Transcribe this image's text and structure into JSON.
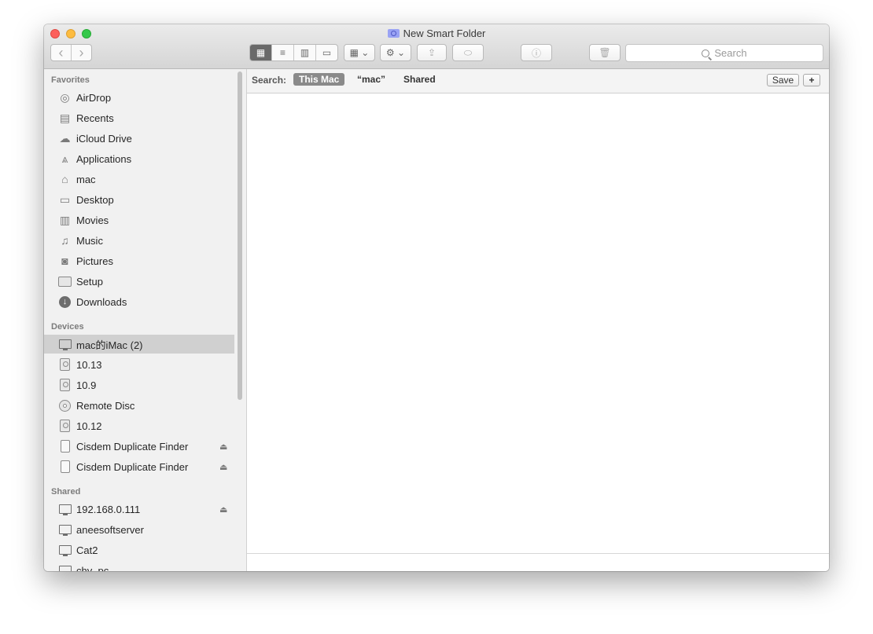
{
  "window": {
    "title": "New Smart Folder"
  },
  "toolbar": {
    "back_icon": "‹",
    "forward_icon": "›",
    "view_icons": [
      "▦",
      "≡",
      "▥",
      "▭"
    ],
    "group_icon": "▦ ⌄",
    "action_icon": "⚙ ⌄",
    "share_icon": "⇪",
    "tag_icon": "⬭",
    "info_icon": "ⓘ",
    "trash_icon": "🗑",
    "search_placeholder": "Search"
  },
  "sidebar": {
    "favorites_title": "Favorites",
    "favorites": [
      {
        "label": "AirDrop",
        "icon": "airdrop-icon"
      },
      {
        "label": "Recents",
        "icon": "recents-icon"
      },
      {
        "label": "iCloud Drive",
        "icon": "cloud-icon"
      },
      {
        "label": "Applications",
        "icon": "applications-icon"
      },
      {
        "label": "mac",
        "icon": "home-icon"
      },
      {
        "label": "Desktop",
        "icon": "desktop-icon"
      },
      {
        "label": "Movies",
        "icon": "film-icon"
      },
      {
        "label": "Music",
        "icon": "music-icon"
      },
      {
        "label": "Pictures",
        "icon": "camera-icon"
      },
      {
        "label": "Setup",
        "icon": "folder-icon"
      },
      {
        "label": "Downloads",
        "icon": "download-icon"
      }
    ],
    "devices_title": "Devices",
    "devices": [
      {
        "label": "mac的iMac (2)",
        "icon": "imac-icon",
        "selected": true
      },
      {
        "label": "10.13",
        "icon": "disk-icon"
      },
      {
        "label": "10.9",
        "icon": "disk-icon"
      },
      {
        "label": "Remote Disc",
        "icon": "cd-icon"
      },
      {
        "label": "10.12",
        "icon": "disk-icon"
      },
      {
        "label": "Cisdem Duplicate Finder",
        "icon": "drive-icon",
        "eject": true
      },
      {
        "label": "Cisdem Duplicate Finder",
        "icon": "drive-icon",
        "eject": true
      }
    ],
    "shared_title": "Shared",
    "shared": [
      {
        "label": "192.168.0.111",
        "icon": "monitor-icon",
        "eject": true
      },
      {
        "label": "aneesoftserver",
        "icon": "monitor-icon"
      },
      {
        "label": "Cat2",
        "icon": "monitor-icon"
      },
      {
        "label": "chy_pc",
        "icon": "monitor-icon"
      }
    ],
    "eject_glyph": "⏏"
  },
  "scope": {
    "label": "Search:",
    "options": [
      "This Mac",
      "“mac”",
      "Shared"
    ],
    "selected": "This Mac",
    "save_label": "Save",
    "add_label": "+"
  }
}
